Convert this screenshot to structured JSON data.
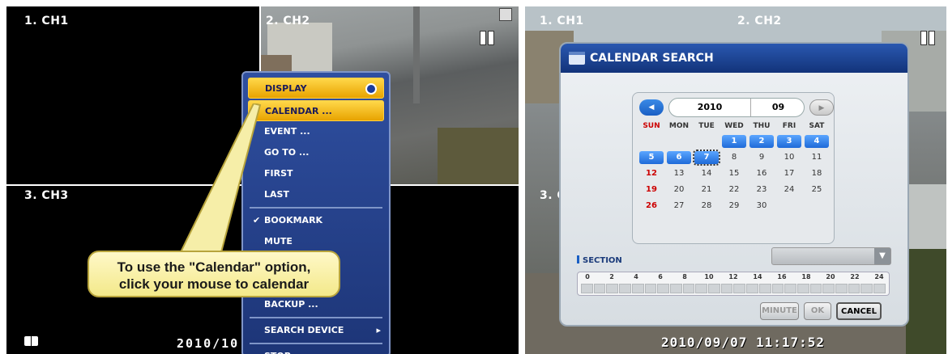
{
  "left": {
    "ch1": "1. CH1",
    "ch2": "2. CH2",
    "ch3": "3. CH3",
    "timestamp": "2010/10",
    "menu": {
      "display": "DISPLAY",
      "calendar": "CALENDAR ...",
      "event": "EVENT ...",
      "goto": "GO TO ...",
      "first": "FIRST",
      "last": "LAST",
      "bookmark": "BOOKMARK",
      "mute": "MUTE",
      "backup": "BACKUP ...",
      "search_device": "SEARCH DEVICE",
      "stop": "STOP"
    },
    "callout": {
      "line1": "To use the \"Calendar\" option,",
      "line2": "click your mouse to calendar"
    }
  },
  "right": {
    "ch1": "1. CH1",
    "ch2": "2. CH2",
    "ch3": "3. C",
    "timestamp": "2010/09/07 11:17:52",
    "dialog": {
      "title": "CALENDAR SEARCH",
      "year": "2010",
      "month": "09",
      "weekdays": [
        "SUN",
        "MON",
        "TUE",
        "WED",
        "THU",
        "FRI",
        "SAT"
      ],
      "days": [
        "",
        "",
        "",
        "1",
        "2",
        "3",
        "4",
        "5",
        "6",
        "7",
        "8",
        "9",
        "10",
        "11",
        "12",
        "13",
        "14",
        "15",
        "16",
        "17",
        "18",
        "19",
        "20",
        "21",
        "22",
        "23",
        "24",
        "25",
        "26",
        "27",
        "28",
        "29",
        "30"
      ],
      "recorded_days": [
        1,
        2,
        3,
        4,
        5,
        6,
        7
      ],
      "selected_day": 7,
      "section_label": "SECTION",
      "timeline_hours": [
        "0",
        "2",
        "4",
        "6",
        "8",
        "10",
        "12",
        "14",
        "16",
        "18",
        "20",
        "22",
        "24"
      ],
      "buttons": {
        "minute": "MINUTE",
        "ok": "OK",
        "cancel": "CANCEL"
      }
    }
  },
  "colors": {
    "menu_bg": "#1d3577",
    "highlight": "#f2b810",
    "accent_blue": "#1e6ad8",
    "callout_bg": "#f6eea8"
  }
}
